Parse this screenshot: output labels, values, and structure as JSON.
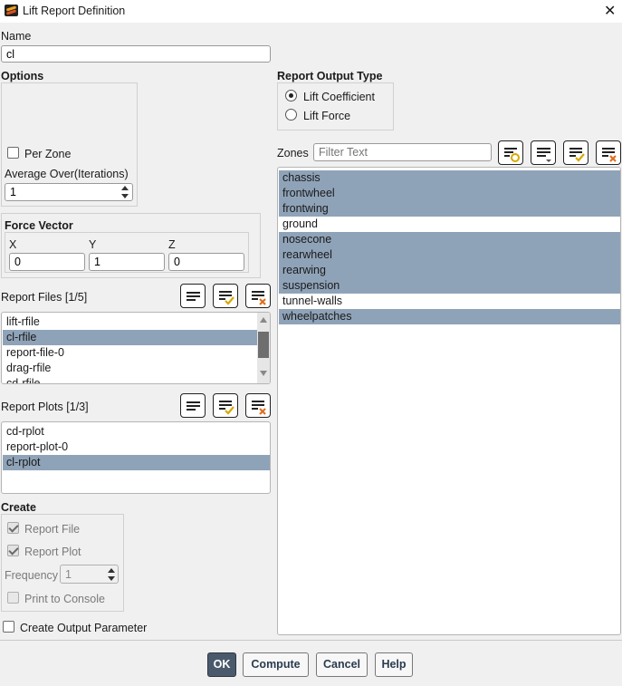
{
  "window": {
    "title": "Lift Report Definition"
  },
  "name": {
    "label": "Name",
    "value": "cl"
  },
  "options": {
    "heading": "Options",
    "per_zone": {
      "label": "Per Zone",
      "checked": false
    },
    "average_over": {
      "label": "Average Over(Iterations)",
      "value": "1"
    }
  },
  "force_vector": {
    "heading": "Force Vector",
    "x": {
      "label": "X",
      "value": "0"
    },
    "y": {
      "label": "Y",
      "value": "1"
    },
    "z": {
      "label": "Z",
      "value": "0"
    }
  },
  "report_output_type": {
    "heading": "Report Output Type",
    "options": [
      {
        "label": "Lift Coefficient",
        "selected": true
      },
      {
        "label": "Lift Force",
        "selected": false
      }
    ]
  },
  "zones": {
    "label": "Zones",
    "filter_placeholder": "Filter Text",
    "items": [
      {
        "label": "chassis",
        "selected": true
      },
      {
        "label": "frontwheel",
        "selected": true
      },
      {
        "label": "frontwing",
        "selected": true
      },
      {
        "label": "ground",
        "selected": false
      },
      {
        "label": "nosecone",
        "selected": true
      },
      {
        "label": "rearwheel",
        "selected": true
      },
      {
        "label": "rearwing",
        "selected": true
      },
      {
        "label": "suspension",
        "selected": true
      },
      {
        "label": "tunnel-walls",
        "selected": false
      },
      {
        "label": "wheelpatches",
        "selected": true
      }
    ]
  },
  "report_files": {
    "label": "Report Files",
    "count": "[1/5]",
    "items": [
      {
        "label": "lift-rfile",
        "selected": false
      },
      {
        "label": "cl-rfile",
        "selected": true
      },
      {
        "label": "report-file-0",
        "selected": false
      },
      {
        "label": "drag-rfile",
        "selected": false
      },
      {
        "label": "cd-rfile",
        "selected": false
      }
    ]
  },
  "report_plots": {
    "label": "Report Plots",
    "count": "[1/3]",
    "items": [
      {
        "label": "cd-rplot",
        "selected": false
      },
      {
        "label": "report-plot-0",
        "selected": false
      },
      {
        "label": "cl-rplot",
        "selected": true
      }
    ]
  },
  "create": {
    "heading": "Create",
    "report_file": {
      "label": "Report File",
      "checked": true
    },
    "report_plot": {
      "label": "Report Plot",
      "checked": true
    },
    "frequency": {
      "label": "Frequency",
      "value": "1"
    },
    "print_to_console": {
      "label": "Print to Console",
      "checked": false
    }
  },
  "create_output_parameter": {
    "label": "Create Output Parameter",
    "checked": false
  },
  "buttons": {
    "ok": "OK",
    "compute": "Compute",
    "cancel": "Cancel",
    "help": "Help"
  },
  "colors": {
    "selection": "#8fa3b8",
    "primary_button": "#4a5a6c",
    "accent_check": "#d8a800",
    "accent_clear": "#e07020"
  }
}
